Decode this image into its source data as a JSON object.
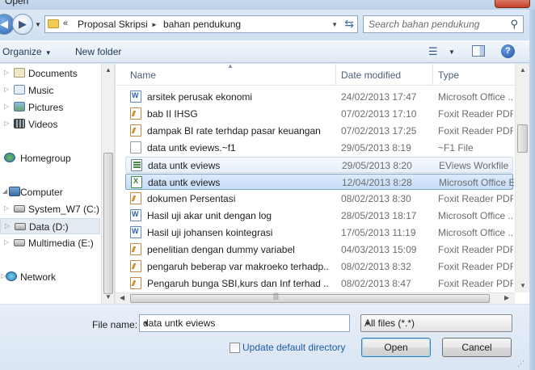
{
  "window": {
    "title": "Open"
  },
  "address": {
    "overflow_chevron": "«",
    "crumbs": [
      "Proposal Skripsi",
      "bahan pendukung"
    ],
    "separator": "►",
    "search_placeholder": "Search bahan pendukung"
  },
  "toolbar": {
    "organize": "Organize",
    "new_folder": "New folder",
    "help": "?"
  },
  "nav": {
    "items": [
      {
        "label": "Documents",
        "icon": "documents-icon"
      },
      {
        "label": "Music",
        "icon": "music-icon"
      },
      {
        "label": "Pictures",
        "icon": "pictures-icon"
      },
      {
        "label": "Videos",
        "icon": "videos-icon"
      },
      {
        "label": "Homegroup",
        "icon": "homegroup-icon"
      },
      {
        "label": "Computer",
        "icon": "computer-icon"
      },
      {
        "label": "System_W7 (C:)",
        "icon": "drive-icon"
      },
      {
        "label": "Data (D:)",
        "icon": "drive-icon"
      },
      {
        "label": "Multimedia (E:)",
        "icon": "drive-icon"
      },
      {
        "label": "Network",
        "icon": "network-icon"
      }
    ]
  },
  "columns": {
    "name": "Name",
    "date": "Date modified",
    "type": "Type"
  },
  "files": [
    {
      "name": "arsitek perusak ekonomi",
      "date": "24/02/2013 17:47",
      "type": "Microsoft Office ...",
      "icon": "word"
    },
    {
      "name": "bab II IHSG",
      "date": "07/02/2013 17:10",
      "type": "Foxit Reader PDF ...",
      "icon": "pdf"
    },
    {
      "name": "dampak BI rate terhdap pasar keuangan",
      "date": "07/02/2013 17:25",
      "type": "Foxit Reader PDF ...",
      "icon": "pdf"
    },
    {
      "name": "data untk eviews.~f1",
      "date": "29/05/2013 8:19",
      "type": "~F1 File",
      "icon": "blank"
    },
    {
      "name": "data untk eviews",
      "date": "29/05/2013 8:20",
      "type": "EViews Workfile",
      "icon": "eviews"
    },
    {
      "name": "data untk eviews",
      "date": "12/04/2013 8:28",
      "type": "Microsoft Office E...",
      "icon": "excel"
    },
    {
      "name": "dokumen Persentasi",
      "date": "08/02/2013 8:30",
      "type": "Foxit Reader PDF ...",
      "icon": "pdf"
    },
    {
      "name": "Hasil uji akar unit dengan log",
      "date": "28/05/2013 18:17",
      "type": "Microsoft Office ...",
      "icon": "word"
    },
    {
      "name": "Hasil uji johansen kointegrasi",
      "date": "17/05/2013 11:19",
      "type": "Microsoft Office ...",
      "icon": "word"
    },
    {
      "name": "penelitian dengan dummy variabel",
      "date": "04/03/2013 15:09",
      "type": "Foxit Reader PDF ...",
      "icon": "pdf"
    },
    {
      "name": "pengaruh beberap var makroeko terhadp...",
      "date": "08/02/2013 8:32",
      "type": "Foxit Reader PDF ...",
      "icon": "pdf"
    },
    {
      "name": "Pengaruh bunga SBI,kurs dan Inf terhad ...",
      "date": "08/02/2013 8:47",
      "type": "Foxit Reader PDF ...",
      "icon": "pdf"
    }
  ],
  "bottom": {
    "file_name_label": "File name:",
    "file_name_value": "data untk eviews",
    "filter_value": "All files (*.*)",
    "update_dir_label": "Update default directory",
    "open_label": "Open",
    "cancel_label": "Cancel"
  }
}
